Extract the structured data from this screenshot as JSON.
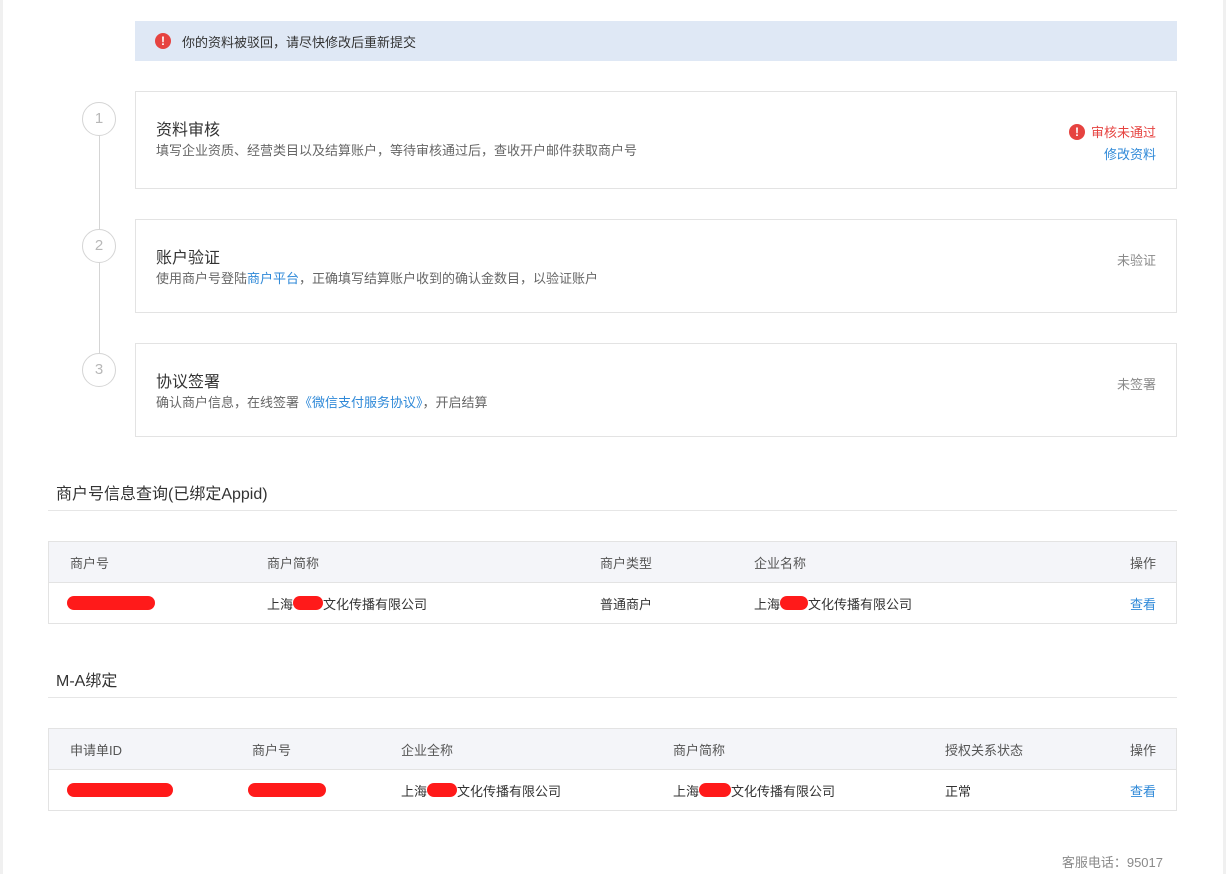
{
  "alert": {
    "icon": "alert-circle-icon",
    "text": "你的资料被驳回，请尽快修改后重新提交"
  },
  "colors": {
    "accent_link": "#2f89d8",
    "error": "#e64340",
    "alert_bg": "#dfe8f5",
    "table_header_bg": "#f4f5f9"
  },
  "steps": [
    {
      "number": "1",
      "title": "资料审核",
      "desc": "填写企业资质、经营类目以及结算账户，等待审核通过后，查收开户邮件获取商户号",
      "status": "审核未通过",
      "status_icon": "error-icon",
      "action": "修改资料"
    },
    {
      "number": "2",
      "title": "账户验证",
      "desc_before": "使用商户号登陆",
      "desc_link": "商户平台",
      "desc_after": "，正确填写结算账户收到的确认金数目，以验证账户",
      "status": "未验证"
    },
    {
      "number": "3",
      "title": "协议签署",
      "desc_before": "确认商户信息，在线签署",
      "desc_link": "《微信支付服务协议》",
      "desc_after": "，开启结算",
      "status": "未签署"
    }
  ],
  "merchant_query": {
    "title": "商户号信息查询(已绑定Appid)",
    "columns": [
      "商户号",
      "商户简称",
      "商户类型",
      "企业名称",
      "操作"
    ],
    "rows": [
      {
        "merchant_id": "",
        "short_name_prefix": "上海",
        "short_name_suffix": "文化传播有限公司",
        "type": "普通商户",
        "company_prefix": "上海",
        "company_suffix": "文化传播有限公司",
        "action": "查看"
      }
    ]
  },
  "ma_binding": {
    "title": "M-A绑定",
    "columns": [
      "申请单ID",
      "商户号",
      "企业全称",
      "商户简称",
      "授权关系状态",
      "操作"
    ],
    "rows": [
      {
        "application_id": "",
        "merchant_id": "",
        "company_prefix": "上海",
        "company_suffix": "文化传播有限公司",
        "short_name_prefix": "上海",
        "short_name_suffix": "文化传播有限公司",
        "status": "正常",
        "action": "查看"
      }
    ]
  },
  "footer": {
    "text": "客服电话：95017"
  }
}
